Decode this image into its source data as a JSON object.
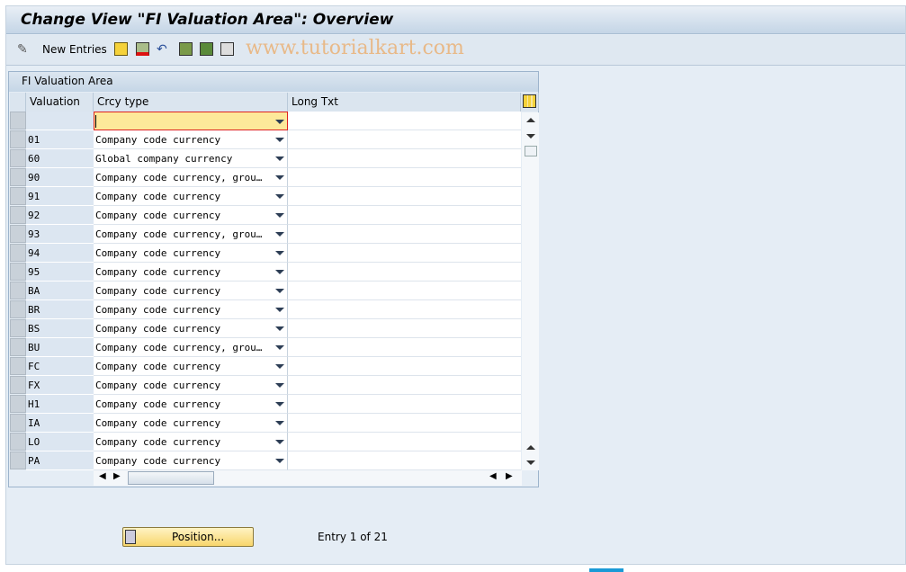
{
  "window": {
    "title": "Change View \"FI Valuation Area\": Overview"
  },
  "toolbar": {
    "new_entries": "New Entries",
    "watermark": "www.tutorialkart.com",
    "icons": [
      "edit-glasses-icon",
      "copy-icon",
      "delete-icon",
      "undo-icon",
      "select-all-icon",
      "select-block-icon",
      "deselect-all-icon"
    ]
  },
  "table": {
    "title": "FI Valuation Area",
    "columns": [
      "Valuation",
      "Crcy type",
      "Long Txt"
    ],
    "rows": [
      {
        "valuation": "",
        "crcy_type": "",
        "long_txt": ""
      },
      {
        "valuation": "01",
        "crcy_type": "Company code currency",
        "long_txt": ""
      },
      {
        "valuation": "60",
        "crcy_type": "Global company currency",
        "long_txt": ""
      },
      {
        "valuation": "90",
        "crcy_type": "Company code currency, grou…",
        "long_txt": ""
      },
      {
        "valuation": "91",
        "crcy_type": "Company code currency",
        "long_txt": ""
      },
      {
        "valuation": "92",
        "crcy_type": "Company code currency",
        "long_txt": ""
      },
      {
        "valuation": "93",
        "crcy_type": "Company code currency, grou…",
        "long_txt": ""
      },
      {
        "valuation": "94",
        "crcy_type": "Company code currency",
        "long_txt": ""
      },
      {
        "valuation": "95",
        "crcy_type": "Company code currency",
        "long_txt": ""
      },
      {
        "valuation": "BA",
        "crcy_type": "Company code currency",
        "long_txt": ""
      },
      {
        "valuation": "BR",
        "crcy_type": "Company code currency",
        "long_txt": ""
      },
      {
        "valuation": "BS",
        "crcy_type": "Company code currency",
        "long_txt": ""
      },
      {
        "valuation": "BU",
        "crcy_type": "Company code currency, grou…",
        "long_txt": ""
      },
      {
        "valuation": "FC",
        "crcy_type": "Company code currency",
        "long_txt": ""
      },
      {
        "valuation": "FX",
        "crcy_type": "Company code currency",
        "long_txt": ""
      },
      {
        "valuation": "H1",
        "crcy_type": "Company code currency",
        "long_txt": ""
      },
      {
        "valuation": "IA",
        "crcy_type": "Company code currency",
        "long_txt": ""
      },
      {
        "valuation": "LO",
        "crcy_type": "Company code currency",
        "long_txt": ""
      },
      {
        "valuation": "PA",
        "crcy_type": "Company code currency",
        "long_txt": ""
      }
    ]
  },
  "footer": {
    "position_button": "Position...",
    "entry_info": "Entry 1 of 21"
  },
  "colors": {
    "active_cell": "#fde99a",
    "button": "#f8d66c"
  }
}
